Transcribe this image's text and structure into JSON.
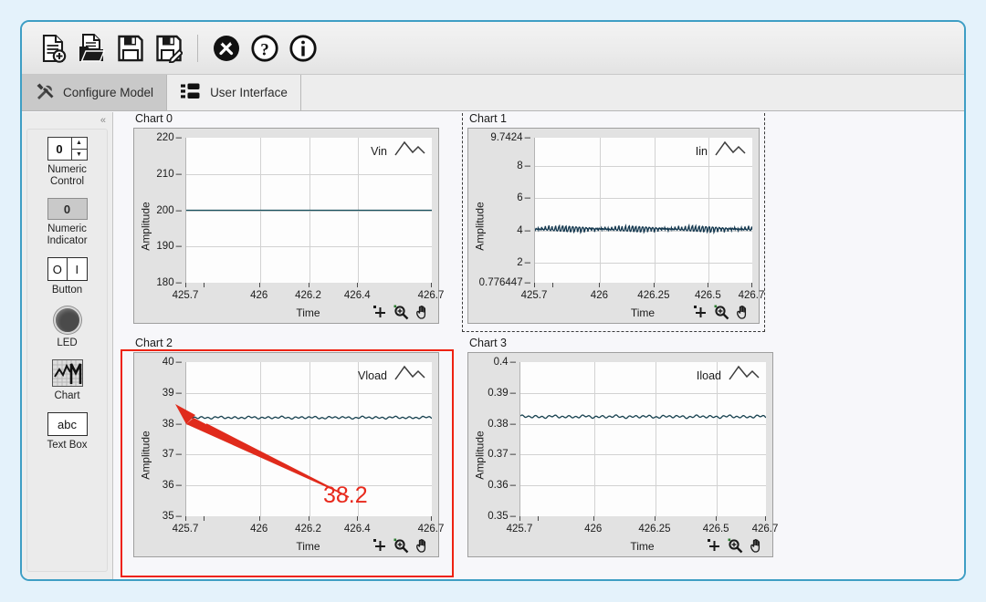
{
  "toolbar": {
    "buttons": [
      {
        "name": "new-model-icon",
        "label": "New Model"
      },
      {
        "name": "open-model-icon",
        "label": "Open Model"
      },
      {
        "name": "save-icon",
        "label": "Save"
      },
      {
        "name": "save-as-icon",
        "label": "Save As"
      },
      {
        "name": "settings-icon",
        "label": "Settings"
      },
      {
        "name": "help-icon",
        "label": "Help"
      },
      {
        "name": "info-icon",
        "label": "Info"
      }
    ]
  },
  "tabs": [
    {
      "label": "Configure Model",
      "icon": "tools-icon",
      "active": false
    },
    {
      "label": "User Interface",
      "icon": "list-icon",
      "active": true
    }
  ],
  "palette": {
    "collapse_glyph": "«",
    "items": [
      {
        "label": "Numeric\nControl",
        "line1": "Numeric",
        "line2": "Control",
        "glyph": "numeric-control",
        "value": "0"
      },
      {
        "label": "Numeric\nIndicator",
        "line1": "Numeric",
        "line2": "Indicator",
        "glyph": "numeric-indicator",
        "value": "0"
      },
      {
        "label": "Button",
        "line1": "Button",
        "line2": "",
        "glyph": "button",
        "off": "O",
        "on": "I"
      },
      {
        "label": "LED",
        "line1": "LED",
        "line2": "",
        "glyph": "led"
      },
      {
        "label": "Chart",
        "line1": "Chart",
        "line2": "",
        "glyph": "chart"
      },
      {
        "label": "Text Box",
        "line1": "Text Box",
        "line2": "",
        "glyph": "text-box",
        "value": "abc"
      }
    ]
  },
  "annotation": {
    "value_label": "38.2",
    "highlight_color": "#ee2211",
    "arrow_color": "#e02b1c"
  },
  "chart_data": [
    {
      "id": "chart0",
      "title": "Chart 0",
      "type": "line",
      "selected": false,
      "series_name": "Vin",
      "ylabel": "Amplitude",
      "xlabel": "Time",
      "ylim": [
        180,
        220
      ],
      "yticks": [
        "180",
        "190",
        "200",
        "210",
        "220"
      ],
      "ytick_values": [
        180,
        190,
        200,
        210,
        220
      ],
      "xlim": [
        425.7,
        426.7
      ],
      "xticks": [
        "425.7",
        "426",
        "426.2",
        "426.4",
        "426.7"
      ],
      "xtick_values": [
        425.7,
        426.0,
        426.2,
        426.4,
        426.7
      ],
      "mean": 200,
      "ripple": 0.0,
      "ripple_kind": "flat",
      "line_color": "#17505e",
      "grid": true
    },
    {
      "id": "chart1",
      "title": "Chart 1",
      "type": "line",
      "selected": true,
      "series_name": "Iin",
      "ylabel": "Amplitude",
      "xlabel": "Time",
      "ylim": [
        0.776447,
        9.7424
      ],
      "yticks": [
        "0.776447",
        "2",
        "4",
        "6",
        "8",
        "9.7424"
      ],
      "ytick_values": [
        0.776447,
        2,
        4,
        6,
        8,
        9.7424
      ],
      "xlim": [
        425.7,
        426.7
      ],
      "xticks": [
        "425.7",
        "426",
        "426.25",
        "426.5",
        "426.7"
      ],
      "xtick_values": [
        425.7,
        426.0,
        426.25,
        426.5,
        426.7
      ],
      "mean": 4.1,
      "ripple": 0.26,
      "ripple_kind": "saw",
      "line_color": "#14384f",
      "grid": true
    },
    {
      "id": "chart2",
      "title": "Chart 2",
      "type": "line",
      "selected": false,
      "highlighted": true,
      "series_name": "Vload",
      "ylabel": "Amplitude",
      "xlabel": "Time",
      "ylim": [
        35,
        40
      ],
      "yticks": [
        "35",
        "36",
        "37",
        "38",
        "39",
        "40"
      ],
      "ytick_values": [
        35,
        36,
        37,
        38,
        39,
        40
      ],
      "xlim": [
        425.7,
        426.7
      ],
      "xticks": [
        "425.7",
        "426",
        "426.2",
        "426.4",
        "426.7"
      ],
      "xtick_values": [
        425.7,
        426.0,
        426.2,
        426.4,
        426.7
      ],
      "mean": 38.2,
      "ripple": 0.05,
      "ripple_kind": "noise",
      "line_color": "#17414f",
      "grid": true
    },
    {
      "id": "chart3",
      "title": "Chart 3",
      "type": "line",
      "selected": false,
      "series_name": "Iload",
      "ylabel": "Amplitude",
      "xlabel": "Time",
      "ylim": [
        0.35,
        0.4
      ],
      "yticks": [
        "0.35",
        "0.36",
        "0.37",
        "0.38",
        "0.39",
        "0.4"
      ],
      "ytick_values": [
        0.35,
        0.36,
        0.37,
        0.38,
        0.39,
        0.4
      ],
      "xlim": [
        425.7,
        426.7
      ],
      "xticks": [
        "425.7",
        "426",
        "426.25",
        "426.5",
        "426.7"
      ],
      "xtick_values": [
        425.7,
        426.0,
        426.25,
        426.5,
        426.7
      ],
      "mean": 0.3823,
      "ripple": 0.0006,
      "ripple_kind": "noise",
      "line_color": "#17414f",
      "grid": true
    }
  ],
  "chart_tools": [
    {
      "name": "cursor-tool-icon",
      "label": "Cursor"
    },
    {
      "name": "zoom-tool-icon",
      "label": "Zoom"
    },
    {
      "name": "pan-tool-icon",
      "label": "Pan"
    }
  ]
}
